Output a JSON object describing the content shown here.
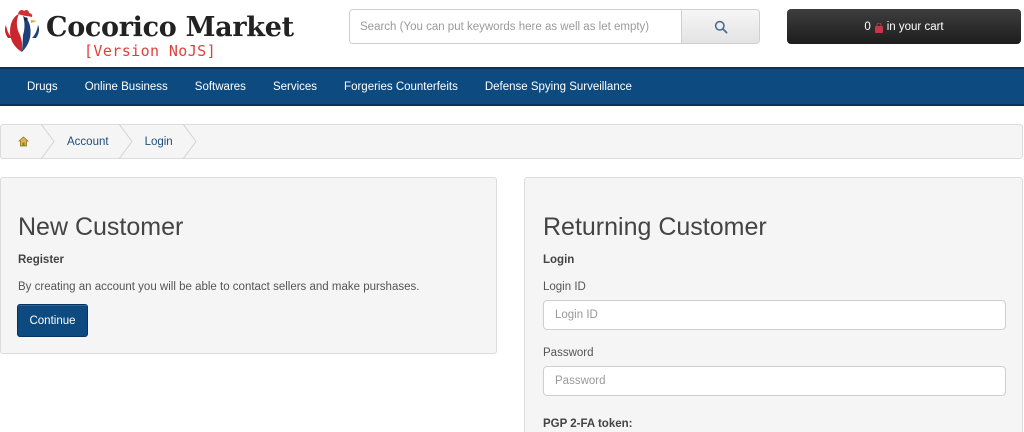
{
  "header": {
    "logo_title": "Cocorico Market",
    "logo_subtitle": "[Version NoJS]",
    "logo_icon": "rooster-icon",
    "search": {
      "placeholder": "Search (You can put keywords here as well as let empty)",
      "value": "",
      "button_icon": "search-icon"
    },
    "cart": {
      "count": "0",
      "icon": "shopping-bag-icon",
      "label": "in your cart"
    }
  },
  "nav": {
    "items": [
      {
        "label": "Drugs"
      },
      {
        "label": "Online Business"
      },
      {
        "label": "Softwares"
      },
      {
        "label": "Services"
      },
      {
        "label": "Forgeries Counterfeits"
      },
      {
        "label": "Defense Spying Surveillance"
      }
    ]
  },
  "breadcrumb": {
    "home_icon": "home-icon",
    "items": [
      {
        "label": "Account"
      },
      {
        "label": "Login"
      }
    ]
  },
  "new_customer": {
    "title": "New Customer",
    "subtitle": "Register",
    "description": "By creating an account you will be able to contact sellers and make purshases.",
    "button_label": "Continue"
  },
  "returning_customer": {
    "title": "Returning Customer",
    "subtitle": "Login",
    "login_id": {
      "label": "Login ID",
      "placeholder": "Login ID",
      "value": ""
    },
    "password": {
      "label": "Password",
      "placeholder": "Password",
      "value": ""
    },
    "pgp_label": "PGP 2-FA token:"
  },
  "colors": {
    "nav_bg": "#0c4a80",
    "accent_red": "#e0403a",
    "cart_bg": "#2a2a2a",
    "panel_bg": "#f5f5f5"
  }
}
